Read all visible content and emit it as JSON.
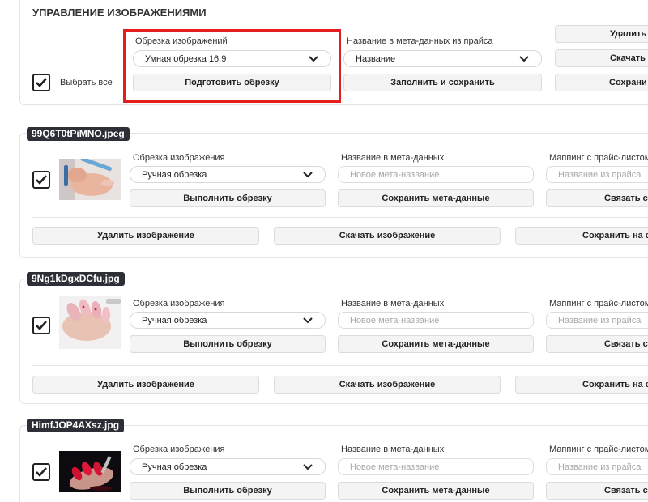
{
  "header": {
    "title": "УПРАВЛЕНИЕ ИЗОБРАЖЕНИЯМИ",
    "select_all_label": "Выбрать все",
    "crop": {
      "label": "Обрезка изображений",
      "selected": "Умная обрезка 16:9",
      "button": "Подготовить обрезку"
    },
    "meta": {
      "label": "Название в мета-данных из прайса",
      "selected": "Название",
      "button": "Заполнить и сохранить"
    },
    "right_buttons": [
      "Удалить и",
      "Скачать и",
      "Сохрани"
    ]
  },
  "item_labels": {
    "crop_label": "Обрезка изображения",
    "crop_value": "Ручная обрезка",
    "crop_button": "Выполнить обрезку",
    "meta_label": "Название в мета-данных",
    "meta_placeholder": "Новое мета-название",
    "meta_button": "Сохранить мета-данные",
    "mapping_label": "Маппинг с прайс-листом",
    "mapping_placeholder": "Название из прайса",
    "mapping_button": "Связать с т",
    "delete_button": "Удалить изображение",
    "download_button": "Скачать изображение",
    "save_button": "Сохранить на се"
  },
  "items": [
    {
      "filename": "99Q6T0tPiMNO.jpeg",
      "thumb": "nail-file-photo"
    },
    {
      "filename": "9Ng1kDgxDCfu.jpg",
      "thumb": "pink-nails-photo"
    },
    {
      "filename": "HimfJOP4AXsz.jpg",
      "thumb": "red-nails-photo"
    }
  ],
  "colors": {
    "highlight": "#e41e1e",
    "tag_bg": "#2c2f36",
    "button_bg": "#f4f4f4"
  }
}
